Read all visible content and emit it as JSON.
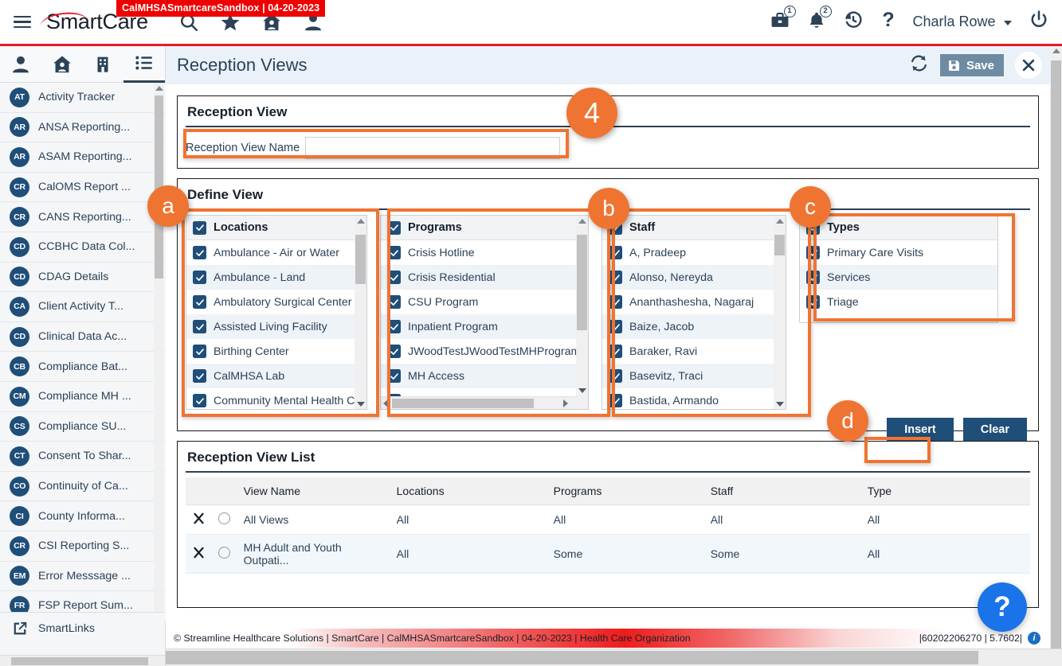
{
  "env_tag": "CalMHSASmartcareSandbox | 04-20-2023",
  "header": {
    "brand": "SmartCare",
    "icons": [
      "search-icon",
      "star-icon",
      "home-icon",
      "person-icon"
    ],
    "briefcase_badge": "1",
    "bell_badge": "2",
    "username": "Charla Rowe",
    "right_icons": [
      "briefcase-icon",
      "bell-icon",
      "history-icon",
      "question-icon",
      "power-icon"
    ]
  },
  "sidebar": {
    "tabs": [
      "person-icon",
      "home-icon",
      "building-icon",
      "list-icon"
    ],
    "active_tab_index": 3,
    "items": [
      {
        "initials": "AT",
        "label": "Activity Tracker"
      },
      {
        "initials": "AR",
        "label": "ANSA Reporting..."
      },
      {
        "initials": "AR",
        "label": "ASAM Reporting..."
      },
      {
        "initials": "CR",
        "label": "CalOMS Report ..."
      },
      {
        "initials": "CR",
        "label": "CANS Reporting..."
      },
      {
        "initials": "CD",
        "label": "CCBHC Data Col..."
      },
      {
        "initials": "CD",
        "label": "CDAG Details"
      },
      {
        "initials": "CA",
        "label": "Client Activity T..."
      },
      {
        "initials": "CD",
        "label": "Clinical Data Ac..."
      },
      {
        "initials": "CB",
        "label": "Compliance Bat..."
      },
      {
        "initials": "CM",
        "label": "Compliance MH ..."
      },
      {
        "initials": "CS",
        "label": "Compliance SU..."
      },
      {
        "initials": "CT",
        "label": "Consent To Shar..."
      },
      {
        "initials": "CO",
        "label": "Continuity of Ca..."
      },
      {
        "initials": "CI",
        "label": "County Informa..."
      },
      {
        "initials": "CR",
        "label": "CSI Reporting S..."
      },
      {
        "initials": "EM",
        "label": "Error Messsage ..."
      },
      {
        "initials": "FR",
        "label": "FSP Report Sum..."
      }
    ],
    "bottom_link": "SmartLinks"
  },
  "page": {
    "title": "Reception Views",
    "save_label": "Save",
    "refresh_icon": "refresh-icon",
    "close_icon": "close-icon"
  },
  "reception_view": {
    "panel_title": "Reception View",
    "name_label": "Reception View Name",
    "name_value": "",
    "name_placeholder": ""
  },
  "define_view": {
    "panel_title": "Define View",
    "lists": [
      {
        "key": "locations",
        "header": "Locations",
        "header_checked": true,
        "items": [
          {
            "label": "Ambulance - Air or Water",
            "checked": true
          },
          {
            "label": "Ambulance - Land",
            "checked": true
          },
          {
            "label": "Ambulatory Surgical Center",
            "checked": true
          },
          {
            "label": "Assisted Living Facility",
            "checked": true
          },
          {
            "label": "Birthing Center",
            "checked": true
          },
          {
            "label": "CalMHSA Lab",
            "checked": true
          },
          {
            "label": "Community Mental Health Cent...",
            "checked": true
          }
        ]
      },
      {
        "key": "programs",
        "header": "Programs",
        "header_checked": true,
        "items": [
          {
            "label": "Crisis Hotline",
            "checked": true
          },
          {
            "label": "Crisis Residential",
            "checked": true
          },
          {
            "label": "CSU Program",
            "checked": true
          },
          {
            "label": "Inpatient Program",
            "checked": true
          },
          {
            "label": "JWoodTestJWoodTestMHProgramN",
            "checked": true
          },
          {
            "label": "MH Access",
            "checked": true
          },
          {
            "label": "MH Adult Outpatient",
            "checked": true
          }
        ]
      },
      {
        "key": "staff",
        "header": "Staff",
        "header_checked": true,
        "items": [
          {
            "label": "A, Pradeep",
            "checked": true
          },
          {
            "label": "Alonso, Nereyda",
            "checked": true
          },
          {
            "label": "Ananthashesha, Nagaraj",
            "checked": true
          },
          {
            "label": "Baize, Jacob",
            "checked": true
          },
          {
            "label": "Baraker, Ravi",
            "checked": true
          },
          {
            "label": "Basevitz, Traci",
            "checked": true
          },
          {
            "label": "Bastida, Armando",
            "checked": true
          }
        ]
      },
      {
        "key": "types",
        "header": "Types",
        "header_checked": true,
        "items": [
          {
            "label": "Primary Care Visits",
            "checked": true
          },
          {
            "label": "Services",
            "checked": true
          },
          {
            "label": "Triage",
            "checked": true
          }
        ]
      }
    ],
    "insert_label": "Insert",
    "clear_label": "Clear"
  },
  "view_list": {
    "panel_title": "Reception View List",
    "columns": [
      "",
      "",
      "View Name",
      "Locations",
      "Programs",
      "Staff",
      "Type"
    ],
    "rows": [
      {
        "view_name": "All Views",
        "locations": "All",
        "programs": "All",
        "staff": "All",
        "type": "All"
      },
      {
        "view_name": "MH Adult and Youth Outpati...",
        "locations": "All",
        "programs": "Some",
        "staff": "Some",
        "type": "All"
      }
    ]
  },
  "footer": {
    "left": "© Streamline Healthcare Solutions | SmartCare | CalMHSASmartcareSandbox | 04-20-2023 | Health Care Organization",
    "right": "|60202206270 | 5.7602|",
    "info_icon": "info-icon"
  },
  "help": {
    "label": "?"
  },
  "annotations": [
    {
      "id": "a",
      "label": "a"
    },
    {
      "id": "b",
      "label": "b"
    },
    {
      "id": "c",
      "label": "c"
    },
    {
      "id": "d",
      "label": "d"
    },
    {
      "id": "4",
      "label": "4"
    }
  ],
  "colors": {
    "accent_orange": "#ef7432",
    "brand_navy": "#1f4e79",
    "alert_red": "#ef0000",
    "header_rule_red": "#e8192c",
    "help_blue": "#1a73e8",
    "page_header_bg": "#eaf1f8"
  }
}
